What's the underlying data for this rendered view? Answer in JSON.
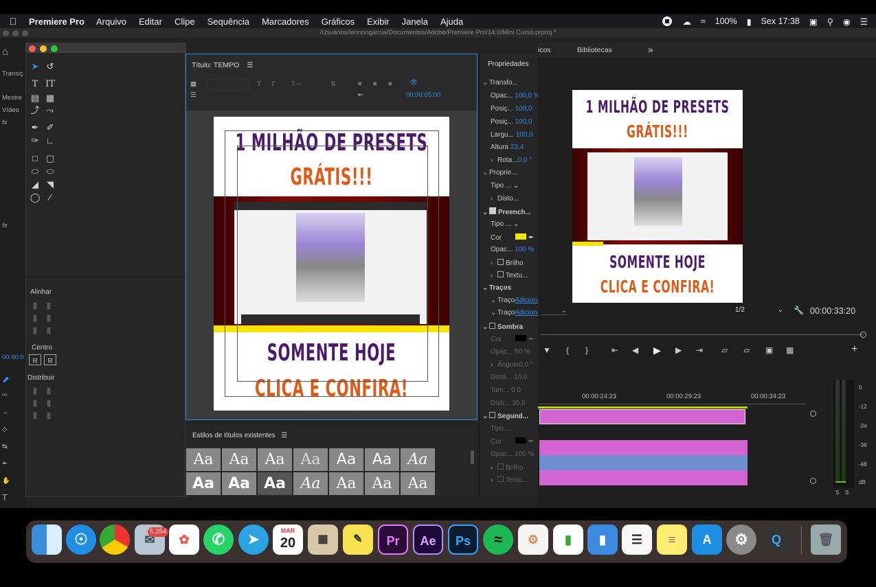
{
  "menubar": {
    "app_name": "Premiere Pro",
    "items": [
      "Arquivo",
      "Editar",
      "Clipe",
      "Sequência",
      "Marcadores",
      "Gráficos",
      "Exibir",
      "Janela",
      "Ajuda"
    ],
    "battery": "100%",
    "clock": "Sex 17:38"
  },
  "window": {
    "path": "/Usuários/lennongarcia/Documentos/Adobe/Premiere Pro/14.0/Mini Curso.prproj *"
  },
  "left_stub": {
    "label_transicoes": "Transiç",
    "label_mestre": "Mestre",
    "label_video": "Vídeo",
    "timecode": "00:00:0"
  },
  "tools": {
    "align": "Alinhar",
    "center": "Centro",
    "distribute": "Distribuir"
  },
  "title_panel": {
    "title": "Título: TEMPO",
    "timecode": "00:00:05:00"
  },
  "graphic": {
    "top_line1": "1 MILHÃO DE PRESETS",
    "top_line2": "GRÁTIS!!!",
    "bottom_line1": "SOMENTE HOJE",
    "bottom_line2": "CLICA E CONFIRA!"
  },
  "properties": {
    "header": "Propriedades",
    "transform": "Transfo...",
    "opacity_label": "Opac...",
    "opacity_value": "100,0 %",
    "posx_label": "Posiç...",
    "posx_value": "100,0",
    "posy_label": "Posiç...",
    "posy_value": "100,0",
    "width_label": "Largu...",
    "width_value": "100,0",
    "height_label": "Altura",
    "height_value": "23,4",
    "rotation_label": "Rota...",
    "rotation_value": "0,0 °",
    "props_section": "Proprie...",
    "type_label": "Tipo ...",
    "distort_label": "Disto...",
    "fill_section": "Preench...",
    "fill_type_label": "Tipo ...",
    "color_label": "Cor",
    "fill_color": "#f5e400",
    "fill_opacity_label": "Opac...",
    "fill_opacity_value": "100 %",
    "brilho": "Brilho",
    "textura": "Textu...",
    "strokes": "Traços",
    "stroke1_label": "Traço",
    "stroke1_add": "Adiciona",
    "stroke2_label": "Traço",
    "stroke2_add": "Adiciona",
    "shadow": "Sombra",
    "shadow_color_label": "Cor",
    "shadow_opacity_label": "Opac...",
    "shadow_opacity_value": "50 %",
    "shadow_angle_label": "Ângulo",
    "shadow_angle_value": "0,0 °",
    "shadow_dist_label": "Distâ...",
    "shadow_dist_value": "10,0",
    "shadow_size_label": "Tam...",
    "shadow_size_value": "0,0",
    "shadow_spread_label": "Distr...",
    "shadow_spread_value": "30,0",
    "second_section": "Segund...",
    "second_type_label": "Tipo ...",
    "second_color_label": "Cor",
    "second_opacity_label": "Opac...",
    "second_opacity_value": "100 %",
    "second_brilho": "Brilho",
    "second_textura": "Textu..."
  },
  "styles_panel": {
    "title": "Estilos de títulos existentes",
    "sample": "Aa"
  },
  "right_panel": {
    "tab_graficos": "icos",
    "tab_bibliotecas": "Bibliotecas",
    "more": "»",
    "zoom_select": "1/2",
    "timecode": "00:00:33:20",
    "ruler": [
      "00:00:24:23",
      "00:00:29:23",
      "00:00:34:23"
    ]
  },
  "meter": {
    "scale": [
      "0",
      "-12",
      "-24",
      "-36",
      "-48",
      "dB"
    ],
    "solo": [
      "S",
      "S"
    ]
  },
  "dock": {
    "mail_badge": "5.254",
    "calendar_month": "MAR",
    "calendar_day": "20"
  }
}
